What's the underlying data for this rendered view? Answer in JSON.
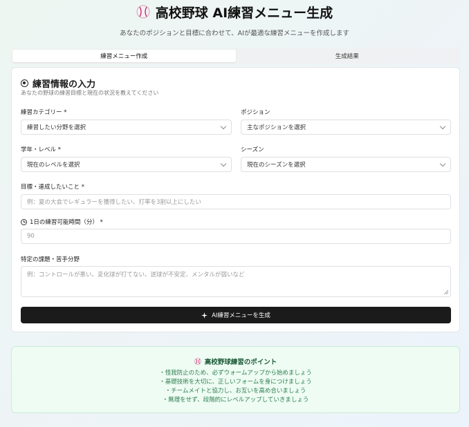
{
  "header": {
    "icon": "baseball-icon",
    "title": "高校野球 AI練習メニュー生成",
    "subtitle": "あなたのポジションと目標に合わせて、AIが最適な練習メニューを作成します"
  },
  "tabs": [
    {
      "label": "練習メニュー作成",
      "active": true
    },
    {
      "label": "生成結果",
      "active": false
    }
  ],
  "form": {
    "title": "練習情報の入力",
    "description": "あなたの野球の練習目標と現在の状況を教えてください",
    "category": {
      "label": "練習カテゴリー *",
      "placeholder": "練習したい分野を選択"
    },
    "position": {
      "label": "ポジション",
      "placeholder": "主なポジションを選択"
    },
    "grade": {
      "label": "学年・レベル *",
      "placeholder": "現在のレベルを選択"
    },
    "season": {
      "label": "シーズン",
      "placeholder": "現在のシーズンを選択"
    },
    "goal": {
      "label": "目標・達成したいこと *",
      "placeholder": "例：夏の大会でレギュラーを獲得したい、打率を3割以上にしたい"
    },
    "time": {
      "label": "1日の練習可能時間（分） *",
      "value": "90"
    },
    "weakness": {
      "label": "特定の課題・苦手分野",
      "placeholder": "例：コントロールが悪い、変化球が打てない、送球が不安定、メンタルが弱いなど"
    },
    "submit_label": "AI練習メニューを生成"
  },
  "tips": {
    "title": "高校野球練習のポイント",
    "items": [
      "・怪我防止のため、必ずウォームアップから始めましょう",
      "・基礎技術を大切に、正しいフォームを身につけましょう",
      "・チームメイトと協力し、お互いを高め合いましょう",
      "・無理をせず、段階的にレベルアップしていきましょう"
    ]
  },
  "colors": {
    "button_bg": "#1b1b1b",
    "tips_bg": "#eefcf3",
    "tips_text": "#2e7d4f"
  }
}
